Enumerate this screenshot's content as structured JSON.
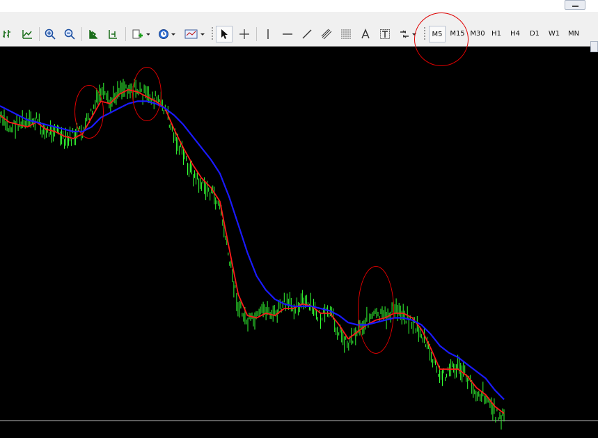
{
  "toolbar": {
    "timeframes": [
      "M5",
      "M15",
      "M30",
      "H1",
      "H4",
      "D1",
      "W1",
      "MN"
    ],
    "active_timeframe": "M5"
  },
  "chart_data": {
    "type": "line",
    "title": "",
    "xlabel": "",
    "ylabel": "",
    "grid": false,
    "background": "#000000",
    "series": [
      {
        "kind": "price-bars",
        "color": "#33ff33",
        "values": [
          0.86,
          0.81,
          0.84,
          0.83,
          0.85,
          0.79,
          0.82,
          0.75,
          0.78,
          0.8,
          0.88,
          0.97,
          0.91,
          0.99,
          0.99,
          0.98,
          0.95,
          0.94,
          0.9,
          0.78,
          0.7,
          0.62,
          0.57,
          0.54,
          0.48,
          0.25,
          0.05,
          -0.02,
          -0.01,
          0.04,
          0.01,
          0.06,
          0.05,
          0.07,
          0.04,
          0.0,
          0.02,
          -0.06,
          -0.11,
          -0.05,
          -0.01,
          0.01,
          0.0,
          0.04,
          0.02,
          -0.02,
          -0.07,
          -0.16,
          -0.26,
          -0.22,
          -0.21,
          -0.26,
          -0.32,
          -0.33,
          -0.41,
          -0.43
        ]
      },
      {
        "kind": "fast-ma",
        "color": "#ff1a1a",
        "values": [
          0.87,
          0.84,
          0.83,
          0.82,
          0.84,
          0.81,
          0.8,
          0.78,
          0.77,
          0.79,
          0.86,
          0.93,
          0.92,
          0.96,
          0.98,
          0.97,
          0.95,
          0.93,
          0.9,
          0.81,
          0.73,
          0.66,
          0.6,
          0.56,
          0.5,
          0.3,
          0.1,
          0.01,
          0.0,
          0.02,
          0.01,
          0.04,
          0.04,
          0.06,
          0.05,
          0.02,
          0.02,
          -0.03,
          -0.09,
          -0.06,
          -0.03,
          -0.01,
          0.0,
          0.02,
          0.02,
          0.0,
          -0.05,
          -0.13,
          -0.22,
          -0.22,
          -0.22,
          -0.25,
          -0.3,
          -0.33,
          -0.38,
          -0.41
        ]
      },
      {
        "kind": "slow-ma",
        "color": "#1a1aff",
        "values": [
          0.91,
          0.89,
          0.87,
          0.85,
          0.84,
          0.83,
          0.82,
          0.81,
          0.8,
          0.8,
          0.82,
          0.86,
          0.88,
          0.9,
          0.92,
          0.93,
          0.93,
          0.92,
          0.9,
          0.87,
          0.83,
          0.78,
          0.73,
          0.68,
          0.62,
          0.52,
          0.4,
          0.28,
          0.18,
          0.12,
          0.08,
          0.06,
          0.05,
          0.05,
          0.05,
          0.04,
          0.03,
          0.01,
          -0.02,
          -0.03,
          -0.03,
          -0.02,
          -0.01,
          0.0,
          0.0,
          -0.01,
          -0.03,
          -0.07,
          -0.12,
          -0.15,
          -0.17,
          -0.2,
          -0.23,
          -0.26,
          -0.31,
          -0.35
        ]
      }
    ],
    "price_level_line": true,
    "annotations": [
      "circle",
      "circle",
      "circle",
      "circle"
    ]
  }
}
